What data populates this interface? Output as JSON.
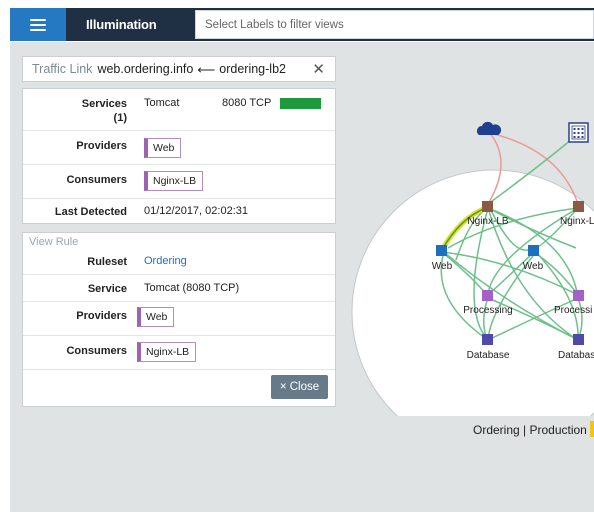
{
  "app": {
    "title": "Illumination",
    "filter_placeholder": "Select Labels to filter views"
  },
  "traffic_link": {
    "kind": "Traffic Link",
    "source": "web.ordering.info",
    "arrow": "⟵",
    "target": "ordering-lb2",
    "close_glyph": "✕"
  },
  "link_details": {
    "services_label": "Services",
    "services_count": "(1)",
    "service_name": "Tomcat",
    "service_port": "8080 TCP",
    "service_status_color": "#1e9a3c",
    "providers_label": "Providers",
    "providers": [
      "Web"
    ],
    "consumers_label": "Consumers",
    "consumers": [
      "Nginx-LB"
    ],
    "last_detected_label": "Last Detected",
    "last_detected": "01/12/2017, 02:02:31"
  },
  "view_rule": {
    "header": "View Rule",
    "ruleset_label": "Ruleset",
    "ruleset": "Ordering",
    "service_label": "Service",
    "service": "Tomcat (8080 TCP)",
    "providers_label": "Providers",
    "providers": [
      "Web"
    ],
    "consumers_label": "Consumers",
    "consumers": [
      "Nginx-LB"
    ],
    "close_label": "× Close"
  },
  "graph": {
    "nodes": {
      "nginx_lb_1": "Nginx-LB",
      "nginx_lb_2": "Nginx-L",
      "web_1": "Web",
      "web_2": "Web",
      "processing_1": "Processing",
      "processing_2": "Processi",
      "database_1": "Database",
      "database_2": "Databas"
    },
    "icons": [
      "cloud-icon",
      "building-icon"
    ],
    "colors": {
      "nginx": "#8a5a44",
      "web": "#1f6fc1",
      "processing": "#a462c9",
      "database": "#4f4aa8",
      "edge": "#6dc08a",
      "internet_edge": "#eb9a96",
      "highlight": "#e6e018"
    },
    "caption": "Ordering | Production"
  }
}
